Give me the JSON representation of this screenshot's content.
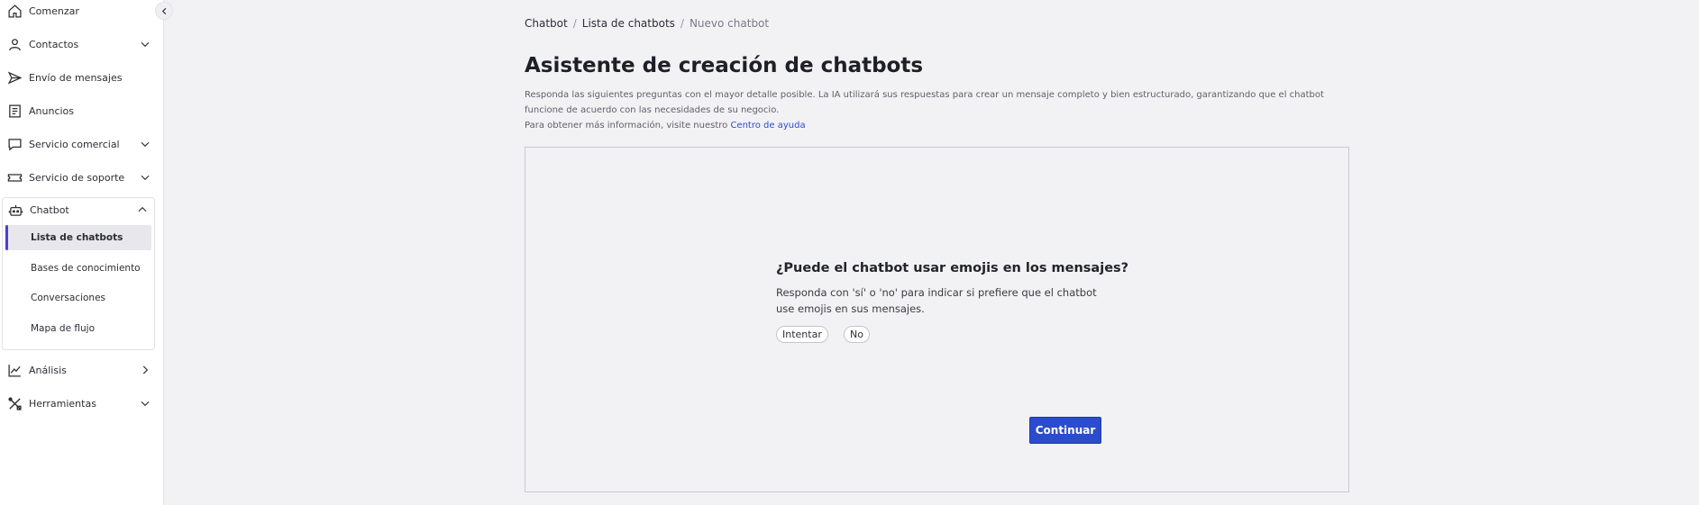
{
  "sidebar": {
    "items": [
      {
        "label": "Comenzar",
        "icon": "home-icon"
      },
      {
        "label": "Contactos",
        "icon": "user-icon"
      },
      {
        "label": "Envío de mensajes",
        "icon": "send-icon"
      },
      {
        "label": "Anuncios",
        "icon": "newspaper-icon"
      },
      {
        "label": "Servicio comercial",
        "icon": "chat-bubble-icon"
      },
      {
        "label": "Servicio de soporte",
        "icon": "ticket-icon"
      },
      {
        "label": "Chatbot",
        "icon": "robot-icon"
      },
      {
        "label": "Análisis",
        "icon": "chart-line-icon"
      },
      {
        "label": "Herramientas",
        "icon": "tools-icon"
      }
    ],
    "chatbot_subitems": [
      {
        "label": "Lista de chatbots",
        "active": true
      },
      {
        "label": "Bases de conocimiento"
      },
      {
        "label": "Conversaciones"
      },
      {
        "label": "Mapa de flujo"
      }
    ]
  },
  "breadcrumb": {
    "items": [
      "Chatbot",
      "Lista de chatbots"
    ],
    "current": "Nuevo chatbot",
    "separator": "/"
  },
  "page": {
    "title": "Asistente de creación de chatbots",
    "description_1": "Responda las siguientes preguntas con el mayor detalle posible. La IA utilizará sus respuestas para crear un mensaje completo y bien estructurado, garantizando que el chatbot funcione de acuerdo con las necesidades de su negocio.",
    "description_2": "Para obtener más información, visite nuestro",
    "help_link": "Centro de ayuda"
  },
  "wizard": {
    "question": "¿Puede el chatbot usar emojis en los mensajes?",
    "hint": "Responda con 'sí' o 'no' para indicar si prefiere que el chatbot use emojis en sus mensajes.",
    "options": [
      "Intentar",
      "No"
    ],
    "continue_label": "Continuar"
  },
  "colors": {
    "accent": "#2b4ccc",
    "active_indicator": "#4a3fd4",
    "background": "#f2f2f5"
  }
}
